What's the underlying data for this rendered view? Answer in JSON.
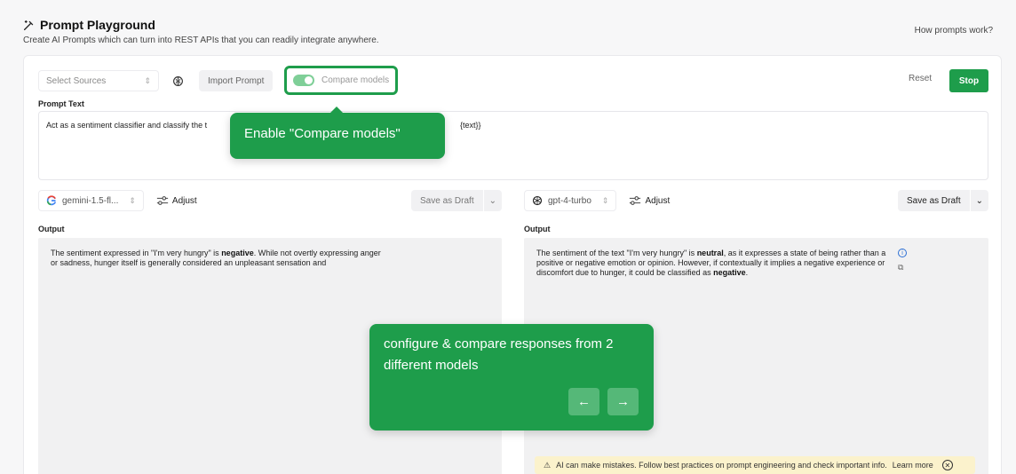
{
  "header": {
    "title": "Prompt Playground",
    "subtitle": "Create AI Prompts which can turn into REST APIs that you can readily integrate anywhere.",
    "help_link": "How prompts work?"
  },
  "toolbar": {
    "select_sources_placeholder": "Select Sources",
    "import_prompt": "Import Prompt",
    "compare_models": "Compare models",
    "compare_enabled": true,
    "reset": "Reset",
    "stop": "Stop"
  },
  "prompt": {
    "label": "Prompt Text",
    "text_start": "Act as a sentiment classifier and classify the t",
    "text_end": "{text}}"
  },
  "left_panel": {
    "model": "gemini-1.5-fl...",
    "adjust": "Adjust",
    "save_draft": "Save as Draft",
    "output_label": "Output",
    "output_pre": "The sentiment expressed in \"I'm very hungry\" is ",
    "output_bold": "negative",
    "output_post": ". While not overtly expressing anger or sadness, hunger itself is generally considered an unpleasant sensation and"
  },
  "right_panel": {
    "model": "gpt-4-turbo",
    "adjust": "Adjust",
    "save_draft": "Save as Draft",
    "output_label": "Output",
    "output_pre": "The sentiment of the text \"I'm very hungry\" is ",
    "output_bold1": "neutral",
    "output_mid": ", as it expresses a state of being rather than a positive or negative emotion or opinion. However, if contextually it implies a negative experience or discomfort due to hunger, it could be classified as ",
    "output_bold2": "negative",
    "output_post": ".",
    "warning": "AI can make mistakes. Follow best practices on prompt engineering and check important info.",
    "warning_link": "Learn more"
  },
  "tour": {
    "step1": "Enable \"Compare models\"",
    "step2": "configure & compare responses from 2 different models",
    "prev_icon": "←",
    "next_icon": "→"
  },
  "colors": {
    "accent": "#1e9d4b",
    "toggle_on": "#7fcf98",
    "warning_bg": "#fbf2cc"
  }
}
